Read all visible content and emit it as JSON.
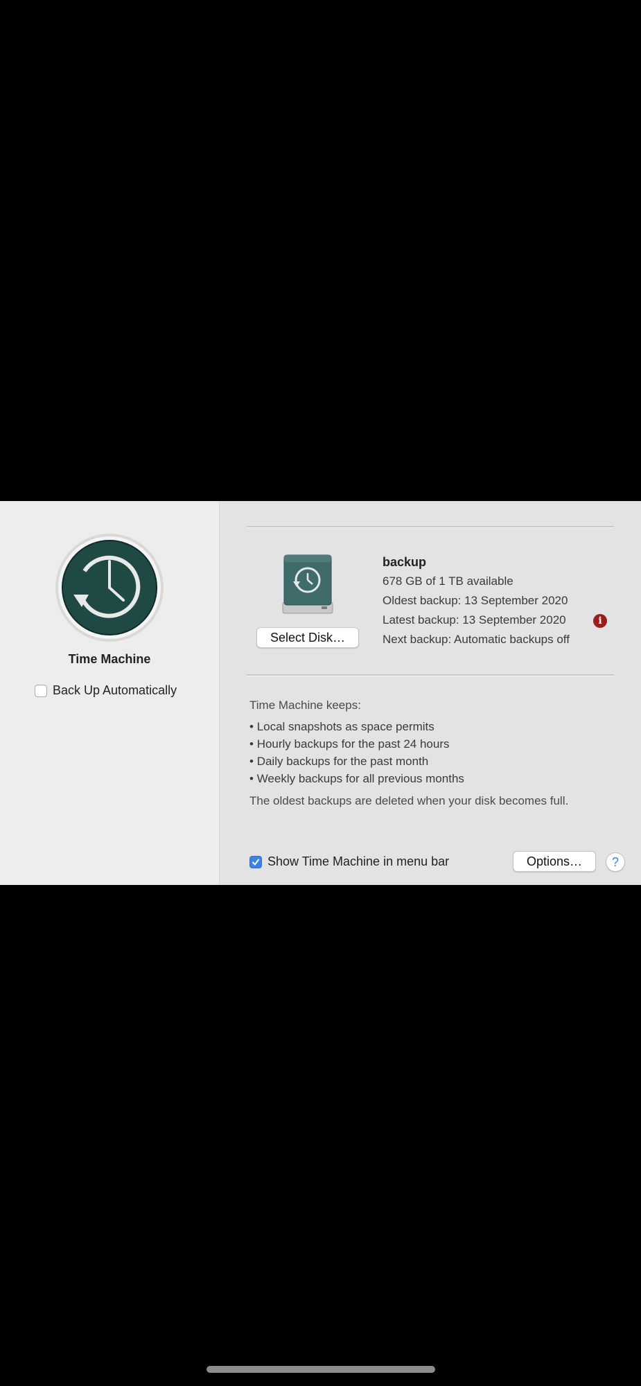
{
  "left_pane": {
    "title": "Time Machine",
    "auto_backup_label": "Back Up Automatically",
    "auto_backup_checked": false
  },
  "disk": {
    "select_button": "Select Disk…",
    "name": "backup",
    "available": "678 GB of 1 TB available",
    "oldest": "Oldest backup: 13 September 2020",
    "latest": "Latest backup: 13 September 2020",
    "next": "Next backup: Automatic backups off",
    "warning_icon": "info-alert-icon",
    "warning_color": "#9e1b1b"
  },
  "keeps": {
    "title": "Time Machine keeps:",
    "items": [
      "Local snapshots as space permits",
      "Hourly backups for the past 24 hours",
      "Daily backups for the past month",
      "Weekly backups for all previous months"
    ],
    "footnote": "The oldest backups are deleted when your disk becomes full."
  },
  "footer": {
    "menu_bar_label": "Show Time Machine in menu bar",
    "menu_bar_checked": true,
    "options_button": "Options…",
    "help_glyph": "?"
  },
  "colors": {
    "accent": "#3b82e6",
    "icon_green": "#1f4a44"
  }
}
